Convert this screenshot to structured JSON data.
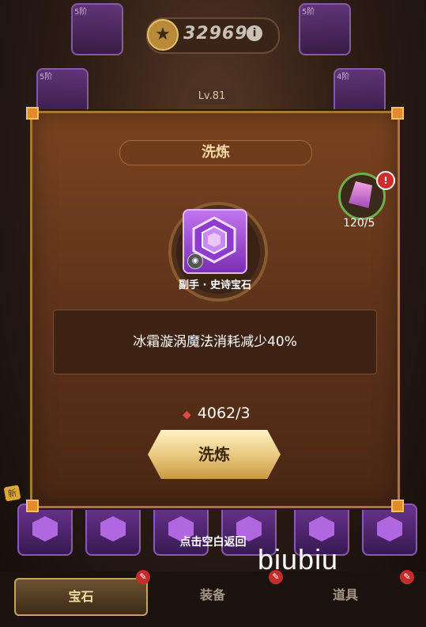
{
  "background": {
    "score": "32969",
    "score_info_glyph": "i",
    "level": "Lv.81",
    "tier_label": "5阶",
    "tier_label_4": "4阶",
    "new_tag": "新"
  },
  "dialog": {
    "title": "洗炼",
    "item_name": "副手 · 史诗宝石",
    "effect": "冰霜漩涡魔法消耗减少40%",
    "cost_icon": "red-crystal-icon",
    "cost": "4062/3",
    "refine_button": "洗炼"
  },
  "side_item": {
    "count": "120/5",
    "badge": "!"
  },
  "hint": "点击空白返回",
  "watermark": "biubiu",
  "tabs": [
    "宝石",
    "装备",
    "道具"
  ],
  "colors": {
    "accent_gold": "#e7c67a",
    "panel_brown": "#5e331a",
    "gem_purple": "#a04ab6",
    "badge_red": "#d02b2b"
  }
}
